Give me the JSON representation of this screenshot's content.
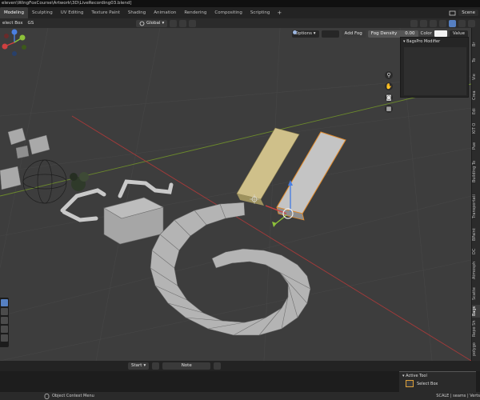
{
  "window": {
    "title": "eleven\\WingFoxCourse\\Artwork\\3D\\LiveRecording03.blend]"
  },
  "workspace_tabs": [
    "Modeling",
    "Sculpting",
    "UV Editing",
    "Texture Paint",
    "Shading",
    "Animation",
    "Rendering",
    "Compositing",
    "Scripting"
  ],
  "active_tab": "Modeling",
  "add_tab": "+",
  "scene": {
    "label": "Scene"
  },
  "header": {
    "mode_fragment": "GS",
    "select_label": "elect Box",
    "orientation": "Global"
  },
  "viewport_header": {
    "options": "Options",
    "add_fog": "Add Fog",
    "fog_density_label": "Fog Density",
    "fog_density_value": "0.00",
    "color_label": "Color",
    "value_label": "Value"
  },
  "bags_panel": {
    "title": "BagsPro Modifier"
  },
  "sidebar_tabs": [
    "Br",
    "To",
    "Vie",
    "Crea",
    "Edi",
    "KIT O",
    "Pue",
    "Building To",
    "Transportati",
    "BPaint",
    "DC",
    "Atmosph",
    "Scatte",
    "Bags",
    "Repo Sh",
    "polygo"
  ],
  "active_sidebar_tab": "Bags",
  "timeline": {
    "start_label": "Start",
    "frame_label": "Note"
  },
  "active_tool": {
    "title": "Active Tool",
    "tool_name": "Select Box"
  },
  "status": {
    "left": "Object Context Menu",
    "right": "SCALE | seams | Verts"
  },
  "colors": {
    "viewport_bg": "#3d3d3d",
    "selection_outline": "#e08a2c",
    "accent_blue": "#5680c2",
    "grid_x_axis": "#a33a3a",
    "grid_y_axis": "#6c8a2c"
  }
}
